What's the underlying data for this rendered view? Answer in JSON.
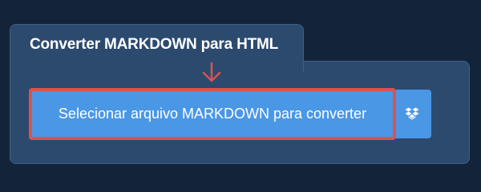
{
  "converter": {
    "title": "Converter MARKDOWN para HTML",
    "upload_label": "Selecionar arquivo MARKDOWN para converter",
    "dropbox_icon": "dropbox-icon"
  },
  "colors": {
    "page_background": "#13243a",
    "panel_background": "#2c4a6e",
    "button_background": "#4a97e6",
    "highlight": "#d9534f"
  }
}
